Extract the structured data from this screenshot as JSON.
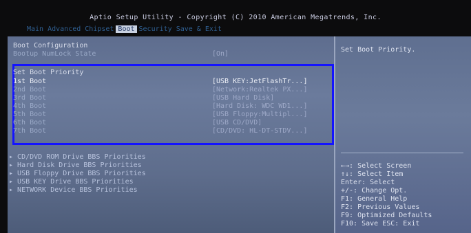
{
  "header": {
    "title": "Aptio Setup Utility - Copyright (C) 2010 American Megatrends, Inc.",
    "tabs": [
      {
        "label": "Main",
        "active": false
      },
      {
        "label": "Advanced",
        "active": false
      },
      {
        "label": "Chipset",
        "active": false
      },
      {
        "label": "Boot",
        "active": true
      },
      {
        "label": "Security",
        "active": false
      },
      {
        "label": "Save & Exit",
        "active": false
      }
    ]
  },
  "main": {
    "section_title": "Boot Configuration",
    "numlock": {
      "label": "Bootup NumLock State",
      "value": "[On]"
    },
    "priority_title": "Set Boot Priority",
    "boot_options": [
      {
        "label": "1st Boot",
        "value": "[USB KEY:JetFlashTr...]"
      },
      {
        "label": "2nd Boot",
        "value": "[Network:Realtek PX...]"
      },
      {
        "label": "3rd Boot",
        "value": "[USB Hard Disk]"
      },
      {
        "label": "4th Boot",
        "value": "[Hard Disk: WDC WD1...]"
      },
      {
        "label": "5th Boot",
        "value": "[USB Floppy:Multipl...]"
      },
      {
        "label": "6th Boot",
        "value": "[USB CD/DVD]"
      },
      {
        "label": "7th Boot",
        "value": "[CD/DVD: HL-DT-STDV...]"
      }
    ],
    "submenus": [
      "CD/DVD ROM Drive BBS Priorities",
      "Hard Disk Drive BBS Priorities",
      "USB Floppy Drive BBS Priorities",
      "USB KEY Drive BBS Priorities",
      "NETWORK Device BBS Priorities"
    ]
  },
  "side": {
    "description": "Set Boot Priority.",
    "help_lines": [
      "←→: Select Screen",
      "↑↓: Select Item",
      "Enter: Select",
      "+/-: Change Opt.",
      "F1: General Help",
      "F2: Previous Values",
      "F9: Optimized Defaults",
      "F10: Save  ESC: Exit"
    ]
  },
  "colors": {
    "highlight_box": "#1414ff",
    "panel_bg": "#65759a",
    "active_tab_bg": "#c9d2e2"
  }
}
